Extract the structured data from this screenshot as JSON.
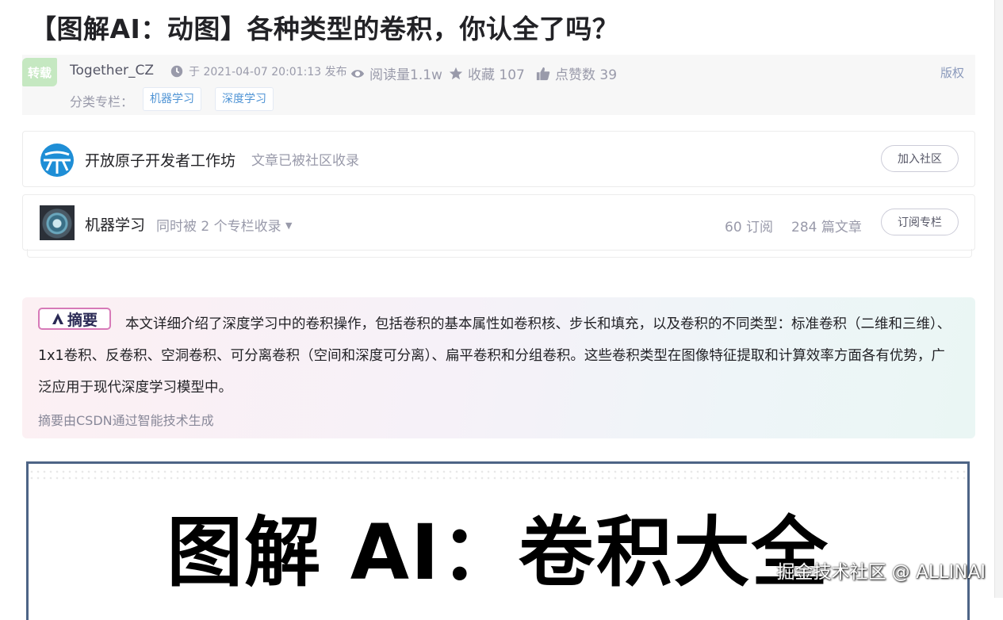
{
  "article": {
    "title": "【图解AI：动图】各种类型的卷积，你认全了吗？",
    "repost_badge": "转载",
    "author": "Together_CZ",
    "publish_time": "于 2021-04-07 20:01:13 发布",
    "views": "阅读量1.1w",
    "collects": "收藏 107",
    "likes": "点赞数 39",
    "copyright": "版权",
    "category_label": "分类专栏：",
    "categories": [
      "机器学习",
      "深度学习"
    ]
  },
  "community": {
    "name": "开放原子开发者工作坊",
    "note": "文章已被社区收录",
    "join_label": "加入社区"
  },
  "column": {
    "name": "机器学习",
    "note": "同时被 2 个专栏收录",
    "subscribers": "60 订阅",
    "articles": "284 篇文章",
    "subscribe_label": "订阅专栏"
  },
  "summary": {
    "badge": "摘要",
    "text": "本文详细介绍了深度学习中的卷积操作，包括卷积的基本属性如卷积核、步长和填充，以及卷积的不同类型：标准卷积（二维和三维）、1x1卷积、反卷积、空洞卷积、可分离卷积（空间和深度可分离）、扁平卷积和分组卷积。这些卷积类型在图像特征提取和计算效率方面各有优势，广泛应用于现代深度学习模型中。",
    "source": "摘要由CSDN通过智能技术生成"
  },
  "hero": {
    "title": "图解 AI：卷积大全"
  },
  "watermark": "掘金技术社区 @ ALLINAI",
  "colors": {
    "accent_blue": "#5094d5",
    "repost_green": "#c5e8c1",
    "badge_pink": "#d77ab8",
    "hero_border": "#4d6486"
  }
}
